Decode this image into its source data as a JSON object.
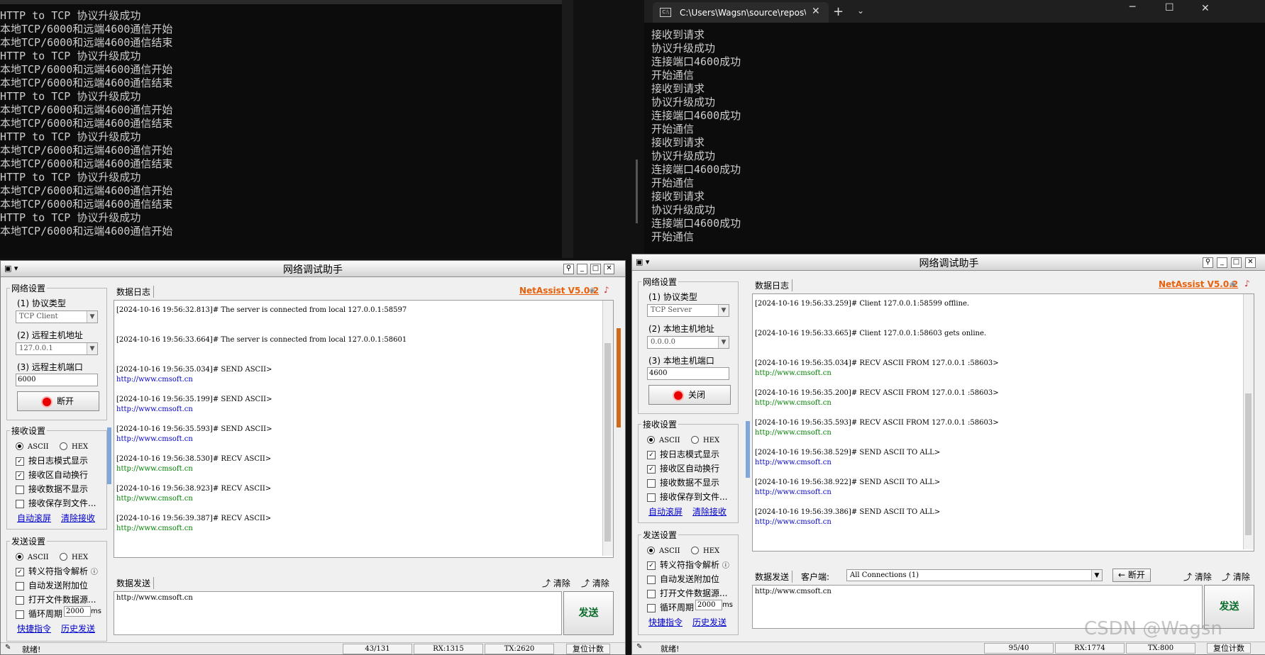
{
  "left_console": {
    "lines": [
      "HTTP to TCP 协议升级成功",
      "本地TCP/6000和远端4600通信开始",
      "本地TCP/6000和远端4600通信结束",
      "HTTP to TCP 协议升级成功",
      "本地TCP/6000和远端4600通信开始",
      "本地TCP/6000和远端4600通信结束",
      "HTTP to TCP 协议升级成功",
      "本地TCP/6000和远端4600通信开始",
      "本地TCP/6000和远端4600通信结束",
      "HTTP to TCP 协议升级成功",
      "本地TCP/6000和远端4600通信开始",
      "本地TCP/6000和远端4600通信结束",
      "HTTP to TCP 协议升级成功",
      "本地TCP/6000和远端4600通信开始",
      "本地TCP/6000和远端4600通信结束",
      "HTTP to TCP 协议升级成功",
      "本地TCP/6000和远端4600通信开始"
    ]
  },
  "right_console": {
    "tab_title": "C:\\Users\\Wagsn\\source\\repos\\",
    "lines": [
      "接收到请求",
      "协议升级成功",
      "连接端口4600成功",
      "开始通信",
      "接收到请求",
      "协议升级成功",
      "连接端口4600成功",
      "开始通信",
      "接收到请求",
      "协议升级成功",
      "连接端口4600成功",
      "开始通信",
      "接收到请求",
      "协议升级成功",
      "连接端口4600成功",
      "开始通信"
    ]
  },
  "common": {
    "window_title": "网络调试助手",
    "brand": "NetAssist V5.0.2",
    "log_tab": "数据日志",
    "send_tab": "数据发送",
    "net_settings": "网络设置",
    "proto_label": "(1) 协议类型",
    "port_label_client": "(3) 远程主机端口",
    "port_label_server": "(3) 本地主机端口",
    "host_label_client": "(2) 远程主机地址",
    "host_label_server": "(2) 本地主机地址",
    "recv_settings": "接收设置",
    "send_settings": "发送设置",
    "ascii": "ASCII",
    "hex": "HEX",
    "log_mode": "按日志模式显示",
    "auto_wrap": "接收区自动换行",
    "no_show": "接收数据不显示",
    "save_file": "接收保存到文件...",
    "auto_scroll": "自动滚屏",
    "clear_recv": "清除接收",
    "escape": "转义符指令解析",
    "auto_append": "自动发送附加位",
    "open_file": "打开文件数据源...",
    "loop": "循环周期",
    "loop_ms": "2000",
    "ms": "ms",
    "shortcut": "快捷指令",
    "history": "历史发送",
    "clear": "清除",
    "send": "发送",
    "ready": "就绪!",
    "reset": "复位计数",
    "send_text": "http://www.cmsoft.cn"
  },
  "client": {
    "protocol": "TCP Client",
    "host": "127.0.0.1",
    "port": "6000",
    "action": "断开",
    "log": [
      {
        "h": "[2024-10-16 19:56:32.813]# The server is connected from local 127.0.0.1:58597",
        "b": ""
      },
      {
        "h": "[2024-10-16 19:56:33.664]# The server is connected from local 127.0.0.1:58601",
        "b": ""
      },
      {
        "h": "[2024-10-16 19:56:35.034]# SEND ASCII>",
        "b": "http://www.cmsoft.cn",
        "c": "u"
      },
      {
        "h": "[2024-10-16 19:56:35.199]# SEND ASCII>",
        "b": "http://www.cmsoft.cn",
        "c": "u"
      },
      {
        "h": "[2024-10-16 19:56:35.593]# SEND ASCII>",
        "b": "http://www.cmsoft.cn",
        "c": "u"
      },
      {
        "h": "[2024-10-16 19:56:38.530]# RECV ASCII>",
        "b": "http://www.cmsoft.cn",
        "c": "g"
      },
      {
        "h": "[2024-10-16 19:56:38.923]# RECV ASCII>",
        "b": "http://www.cmsoft.cn",
        "c": "g"
      },
      {
        "h": "[2024-10-16 19:56:39.387]# RECV ASCII>",
        "b": "http://www.cmsoft.cn",
        "c": "g"
      }
    ],
    "status_count": "43/131",
    "rx": "RX:1315",
    "tx": "TX:2620"
  },
  "server": {
    "protocol": "TCP Server",
    "host": "0.0.0.0",
    "port": "4600",
    "action": "关闭",
    "client_label": "客户端:",
    "client_select": "All Connections (1)",
    "disconnect": "断开",
    "log": [
      {
        "h": "[2024-10-16 19:56:33.259]# Client 127.0.0.1:58599 offline.",
        "b": ""
      },
      {
        "h": "[2024-10-16 19:56:33.665]# Client 127.0.0.1:58603 gets online.",
        "b": ""
      },
      {
        "h": "[2024-10-16 19:56:35.034]# RECV ASCII FROM 127.0.0.1 :58603>",
        "b": "http://www.cmsoft.cn",
        "c": "g"
      },
      {
        "h": "[2024-10-16 19:56:35.200]# RECV ASCII FROM 127.0.0.1 :58603>",
        "b": "http://www.cmsoft.cn",
        "c": "g"
      },
      {
        "h": "[2024-10-16 19:56:35.593]# RECV ASCII FROM 127.0.0.1 :58603>",
        "b": "http://www.cmsoft.cn",
        "c": "g"
      },
      {
        "h": "[2024-10-16 19:56:38.529]# SEND ASCII TO ALL>",
        "b": "http://www.cmsoft.cn",
        "c": "u"
      },
      {
        "h": "[2024-10-16 19:56:38.922]# SEND ASCII TO ALL>",
        "b": "http://www.cmsoft.cn",
        "c": "u"
      },
      {
        "h": "[2024-10-16 19:56:39.386]# SEND ASCII TO ALL>",
        "b": "http://www.cmsoft.cn",
        "c": "u"
      }
    ],
    "status_count": "95/40",
    "rx": "RX:1774",
    "tx": "TX:800"
  },
  "watermark": "CSDN @Wagsn"
}
